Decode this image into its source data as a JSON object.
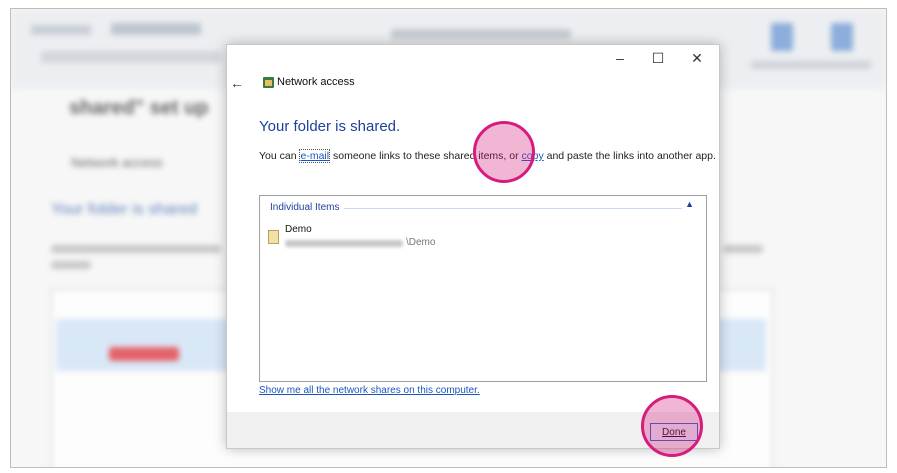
{
  "dialog": {
    "title": "Network access",
    "controls": {
      "minimize": "–",
      "maximize": "☐",
      "close": "✕"
    },
    "back": "←",
    "heading": "Your folder is shared.",
    "message": {
      "before": "You can ",
      "email_link": "e-mail",
      "middle": " someone links to these shared items, or ",
      "copy_link": "copy",
      "after": " and paste the links into another app."
    },
    "list": {
      "group_header": "Individual Items",
      "chevron": "▲",
      "items": [
        {
          "name": "Demo",
          "path_visible_suffix": "\\Demo"
        }
      ]
    },
    "show_shares_link": "Show me all the network shares on this computer.",
    "done_button": "Done"
  },
  "annotations": {
    "highlight_color": "#d61c7c"
  },
  "icons": [
    "back-arrow-icon",
    "network-access-icon",
    "file-icon",
    "chevron-up-icon"
  ]
}
